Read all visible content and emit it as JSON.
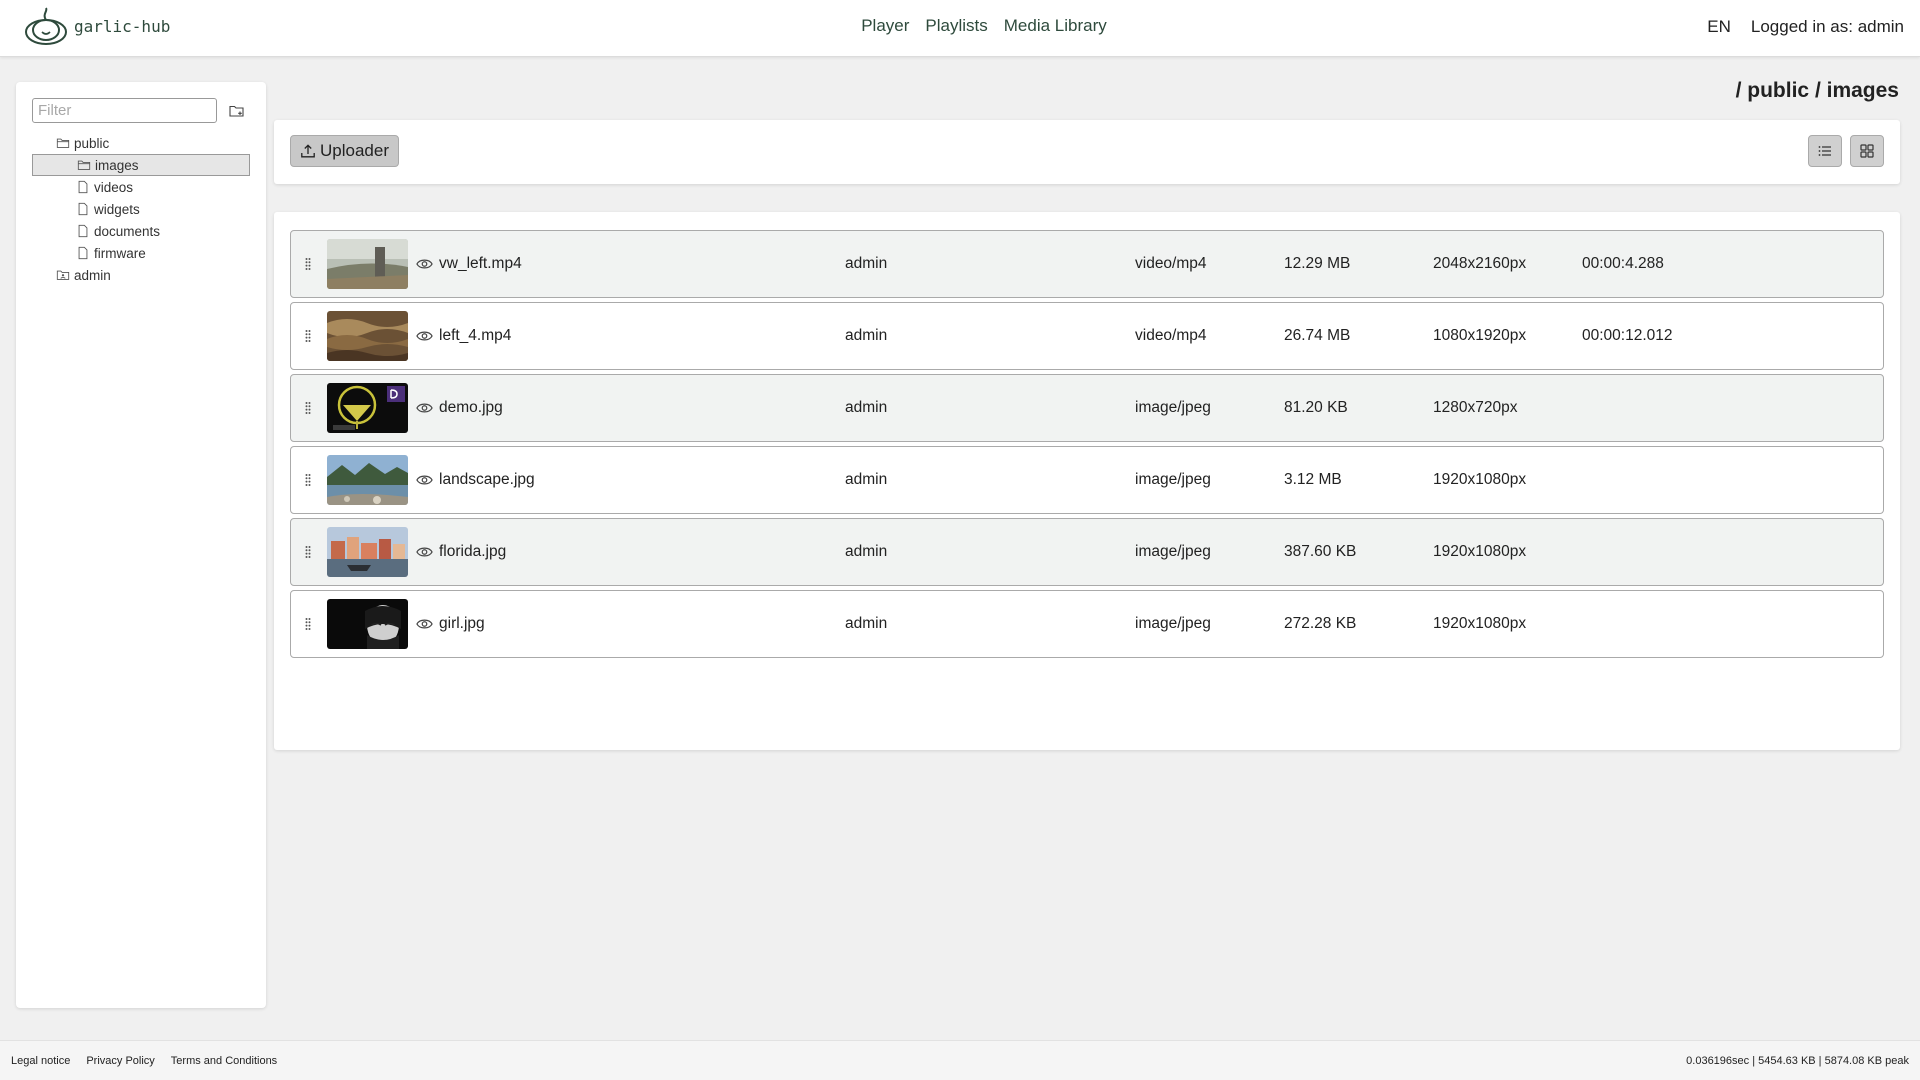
{
  "header": {
    "logo_text": "garlic-hub",
    "nav": [
      "Player",
      "Playlists",
      "Media Library"
    ],
    "language": "EN",
    "user_status": "Logged in as: admin"
  },
  "sidebar": {
    "filter_placeholder": "Filter",
    "tree": [
      {
        "label": "public",
        "level": 0,
        "icon": "folder-open-icon"
      },
      {
        "label": "images",
        "level": 1,
        "icon": "folder-open-icon",
        "selected": true
      },
      {
        "label": "videos",
        "level": 1,
        "icon": "file-icon"
      },
      {
        "label": "widgets",
        "level": 1,
        "icon": "file-icon"
      },
      {
        "label": "documents",
        "level": 1,
        "icon": "file-icon"
      },
      {
        "label": "firmware",
        "level": 1,
        "icon": "file-icon"
      },
      {
        "label": "admin",
        "level": 0,
        "icon": "user-folder-icon"
      }
    ]
  },
  "main": {
    "breadcrumb": "/ public / images",
    "toolbar": {
      "uploader_label": "Uploader"
    },
    "media": [
      {
        "name": "vw_left.mp4",
        "owner": "admin",
        "mime": "video/mp4",
        "size": "12.29 MB",
        "dimensions": "2048x2160px",
        "duration": "00:00:4.288",
        "thumb": "road-scene"
      },
      {
        "name": "left_4.mp4",
        "owner": "admin",
        "mime": "video/mp4",
        "size": "26.74 MB",
        "dimensions": "1080x1920px",
        "duration": "00:00:12.012",
        "thumb": "waves"
      },
      {
        "name": "demo.jpg",
        "owner": "admin",
        "mime": "image/jpeg",
        "size": "81.20 KB",
        "dimensions": "1280x720px",
        "duration": "",
        "thumb": "cocktail"
      },
      {
        "name": "landscape.jpg",
        "owner": "admin",
        "mime": "image/jpeg",
        "size": "3.12 MB",
        "dimensions": "1920x1080px",
        "duration": "",
        "thumb": "lake"
      },
      {
        "name": "florida.jpg",
        "owner": "admin",
        "mime": "image/jpeg",
        "size": "387.60 KB",
        "dimensions": "1920x1080px",
        "duration": "",
        "thumb": "harbor"
      },
      {
        "name": "girl.jpg",
        "owner": "admin",
        "mime": "image/jpeg",
        "size": "272.28 KB",
        "dimensions": "1920x1080px",
        "duration": "",
        "thumb": "portrait-bw"
      }
    ]
  },
  "footer": {
    "links": [
      "Legal notice",
      "Privacy Policy",
      "Terms and Conditions"
    ],
    "stats": "0.036196sec | 5454.63 KB | 5874.08 KB peak"
  }
}
